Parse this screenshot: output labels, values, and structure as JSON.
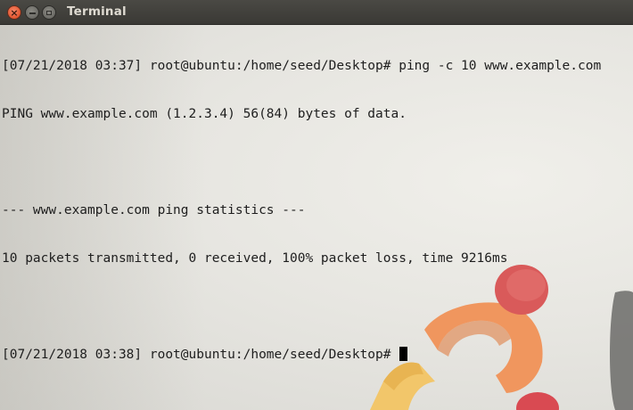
{
  "window": {
    "title": "Terminal",
    "controls": {
      "close_icon": "close-icon",
      "minimize_icon": "minimize-icon",
      "maximize_icon": "maximize-icon"
    }
  },
  "terminal": {
    "lines": [
      "[07/21/2018 03:37] root@ubuntu:/home/seed/Desktop# ping -c 10 www.example.com",
      "PING www.example.com (1.2.3.4) 56(84) bytes of data.",
      "",
      "--- www.example.com ping statistics ---",
      "10 packets transmitted, 0 received, 100% packet loss, time 9216ms",
      ""
    ],
    "prompt": "[07/21/2018 03:37] root@ubuntu:/home/seed/Desktop#",
    "current_prompt": "[07/21/2018 03:38] root@ubuntu:/home/seed/Desktop# "
  },
  "colors": {
    "close": "#e0552f",
    "text": "#1e1e1e",
    "titlebar": "#3c3b37"
  }
}
